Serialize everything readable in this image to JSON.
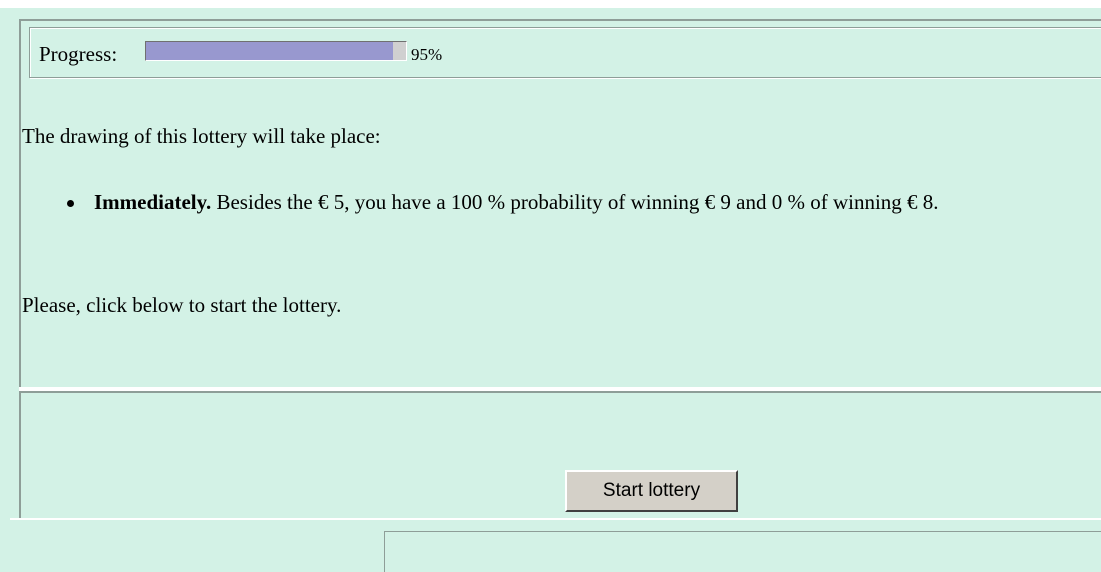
{
  "progress": {
    "label": "Progress:",
    "percent_text": "95%",
    "value": 0.95
  },
  "content": {
    "intro": "The drawing of this lottery will take place:",
    "options": [
      {
        "title": "Immediately.",
        "text": " Besides the € 5, you have a 100 % probability of winning € 9 and 0 % of winning € 8."
      }
    ],
    "outro": "Please, click below to start the lottery."
  },
  "actions": {
    "start_label": "Start lottery"
  },
  "colors": {
    "background": "#d3f2e6",
    "progress_fill": "#9898cf",
    "button_face": "#d4d0c8"
  }
}
